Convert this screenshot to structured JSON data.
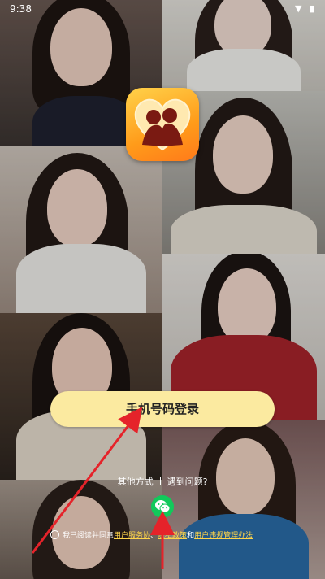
{
  "status_bar": {
    "time": "9:38",
    "icons": "▼ ▮"
  },
  "login_button": {
    "label": "手机号码登录"
  },
  "other_methods": {
    "label": "其他方式",
    "help": "遇到问题?"
  },
  "wechat": {
    "icon": "wechat-icon"
  },
  "agreement": {
    "prefix": "我已阅读并同意",
    "link_user": "用户服务协",
    "sep1": "、",
    "link_privacy": "隐私政策",
    "and": "和",
    "link_rules": "用户违规管理办法"
  },
  "colors": {
    "login_bg": "#fbeaa0",
    "link": "#ffd54a",
    "wechat": "#12c95b",
    "annotation": "#e5232a"
  }
}
